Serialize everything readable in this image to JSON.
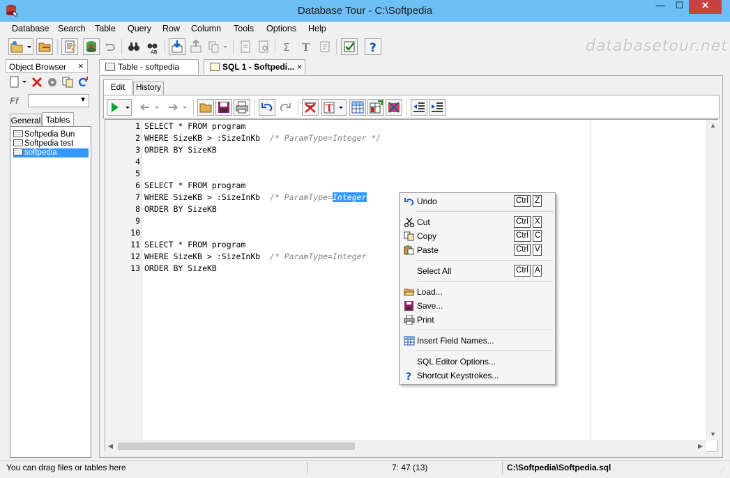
{
  "window": {
    "title": "Database Tour - C:\\Softpedia",
    "minimize_glyph": "—",
    "maximize_glyph": "☐",
    "close_glyph": "✕"
  },
  "menu": [
    "Database",
    "Search",
    "Table",
    "Query",
    "Row",
    "Column",
    "Tools",
    "Options",
    "Help"
  ],
  "watermark": "databasetour.net",
  "object_browser": {
    "title": "Object Browser",
    "close_glyph": "×",
    "filter_icon_text": "Ff",
    "tabs": [
      "General",
      "Tables"
    ],
    "active_tab": "Tables",
    "items": [
      "Softpedia Bun",
      "Softpedia test",
      "softpedia"
    ],
    "selected_item": "softpedia"
  },
  "document_tabs": [
    {
      "label": "Table - softpedia"
    },
    {
      "label": "SQL 1 - Softpedi...",
      "close": "×",
      "active": true
    }
  ],
  "editor": {
    "tabs": [
      "Edit",
      "History"
    ],
    "active_tab": "Edit",
    "line_numbers": [
      "1",
      "2",
      "3",
      "4",
      "5",
      "6",
      "7",
      "8",
      "9",
      "10",
      "11",
      "12",
      "13"
    ],
    "lines": [
      {
        "code": "SELECT * FROM program",
        "comment": ""
      },
      {
        "code": "WHERE SizeKB > :SizeInKb  ",
        "comment": "/* ParamType=Integer */"
      },
      {
        "code": "ORDER BY SizeKB",
        "comment": ""
      },
      {
        "code": "",
        "comment": ""
      },
      {
        "code": "",
        "comment": ""
      },
      {
        "code": "SELECT * FROM program",
        "comment": ""
      },
      {
        "code": "WHERE SizeKB > :SizeInKb  ",
        "comment": "/* ParamType=",
        "selected": "Integer"
      },
      {
        "code": "ORDER BY SizeKB",
        "comment": ""
      },
      {
        "code": "",
        "comment": ""
      },
      {
        "code": "",
        "comment": ""
      },
      {
        "code": "SELECT * FROM program",
        "comment": ""
      },
      {
        "code": "WHERE SizeKB > :SizeInKb  ",
        "comment": "/* ParamType=Integer"
      },
      {
        "code": "ORDER BY SizeKB",
        "comment": ""
      }
    ]
  },
  "context_menu": {
    "items": [
      {
        "label": "Undo",
        "icon": "undo-icon",
        "key1": "Ctrl",
        "key2": "Z"
      },
      {
        "label": "Cut",
        "icon": "scissors-icon",
        "key1": "Ctrl",
        "key2": "X"
      },
      {
        "label": "Copy",
        "icon": "copy-icon",
        "key1": "Ctrl",
        "key2": "C"
      },
      {
        "label": "Paste",
        "icon": "paste-icon",
        "key1": "Ctrl",
        "key2": "V"
      },
      {
        "label": "Select All",
        "icon": "",
        "key1": "Ctrl",
        "key2": "A"
      },
      {
        "label": "Load...",
        "icon": "folder-open-icon"
      },
      {
        "label": "Save...",
        "icon": "floppy-icon"
      },
      {
        "label": "Print",
        "icon": "printer-icon"
      },
      {
        "label": "Insert Field Names...",
        "icon": "insert-fields-icon"
      },
      {
        "label": "SQL Editor Options...",
        "icon": ""
      },
      {
        "label": "Shortcut Keystrokes...",
        "icon": "help-icon"
      }
    ]
  },
  "status_bar": {
    "hint": "You can drag files or tables here",
    "position": "7:  47  (13)",
    "file": "C:\\Softpedia\\Softpedia.sql"
  },
  "colors": {
    "titlebar": "#6dc0f5",
    "close_button": "#c74343",
    "selection": "#3399ff",
    "comment": "#808080"
  }
}
